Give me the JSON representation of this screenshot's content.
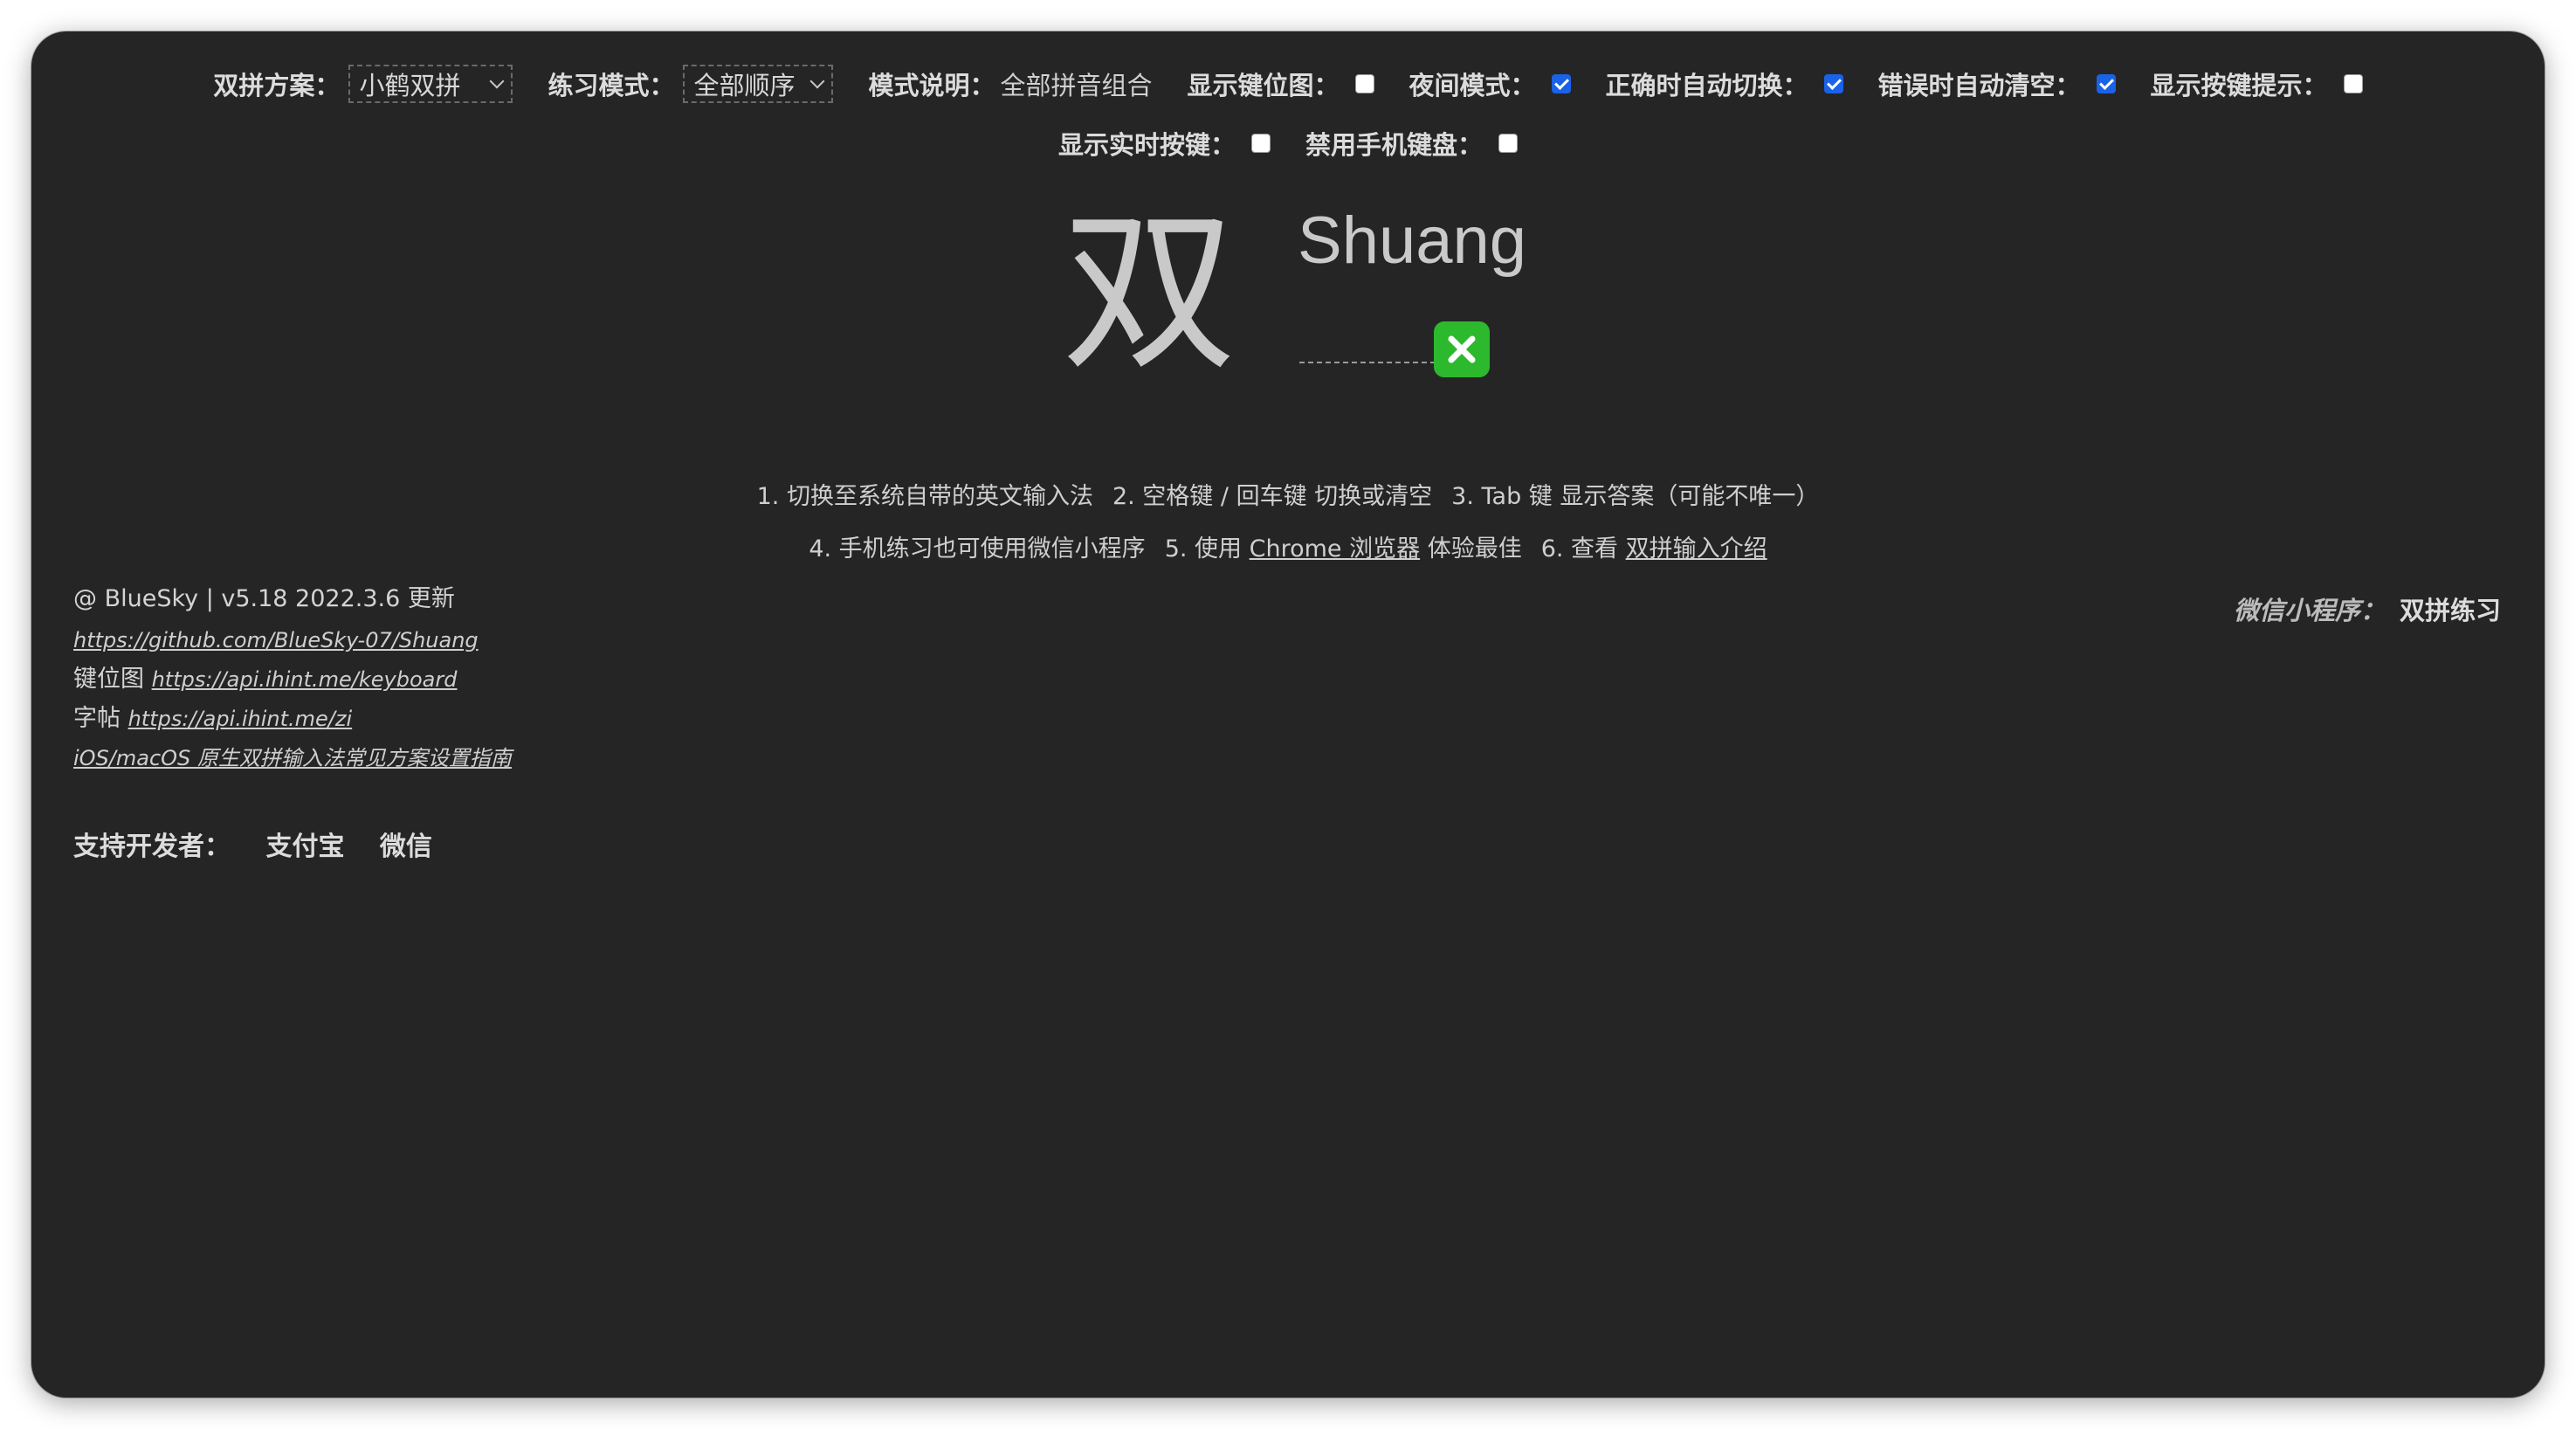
{
  "settings": {
    "scheme": {
      "label": "双拼方案：",
      "value": "小鹤双拼"
    },
    "mode": {
      "label": "练习模式：",
      "value": "全部顺序"
    },
    "mode_desc": {
      "label": "模式说明：",
      "value": "全部拼音组合"
    },
    "show_keymap": {
      "label": "显示键位图：",
      "checked": false
    },
    "night_mode": {
      "label": "夜间模式：",
      "checked": true
    },
    "auto_next": {
      "label": "正确时自动切换：",
      "checked": true
    },
    "auto_clear": {
      "label": "错误时自动清空：",
      "checked": true
    },
    "show_key_hint": {
      "label": "显示按键提示：",
      "checked": false
    },
    "show_realtime_keys": {
      "label": "显示实时按键：",
      "checked": false
    },
    "disable_mobile_keyboard": {
      "label": "禁用手机键盘：",
      "checked": false
    }
  },
  "practice": {
    "character": "双",
    "pinyin": "Shuang",
    "input_value": "",
    "status": "incorrect",
    "status_icon": "cross-mark-icon",
    "status_color": "#2db92d"
  },
  "tips": {
    "t1": "1. 切换至系统自带的英文输入法",
    "t2": "2. 空格键 / 回车键 切换或清空",
    "t3": "3. Tab 键 显示答案（可能不唯一）",
    "t4": "4. 手机练习也可使用微信小程序",
    "t5_pre": "5. 使用",
    "t5_link": "Chrome 浏览器",
    "t5_post": "体验最佳",
    "t6_pre": "6. 查看",
    "t6_link": "双拼输入介绍"
  },
  "footer": {
    "version": "@ BlueSky | v5.18 2022.3.6 更新",
    "github": "https://github.com/BlueSky-07/Shuang",
    "keymap_label": "键位图",
    "keymap_link": "https://api.ihint.me/keyboard",
    "zi_label": "字帖",
    "zi_link": "https://api.ihint.me/zi",
    "guide_link": "iOS/macOS 原生双拼输入法常见方案设置指南",
    "support_label": "支持开发者：",
    "support_alipay": "支付宝",
    "support_wechat": "微信",
    "miniprogram_label": "微信小程序：",
    "miniprogram_name": "双拼练习"
  },
  "colors": {
    "background": "#252525",
    "text": "#d8d8d8",
    "checkbox_on": "#1a62e6",
    "status_green": "#2db92d"
  }
}
